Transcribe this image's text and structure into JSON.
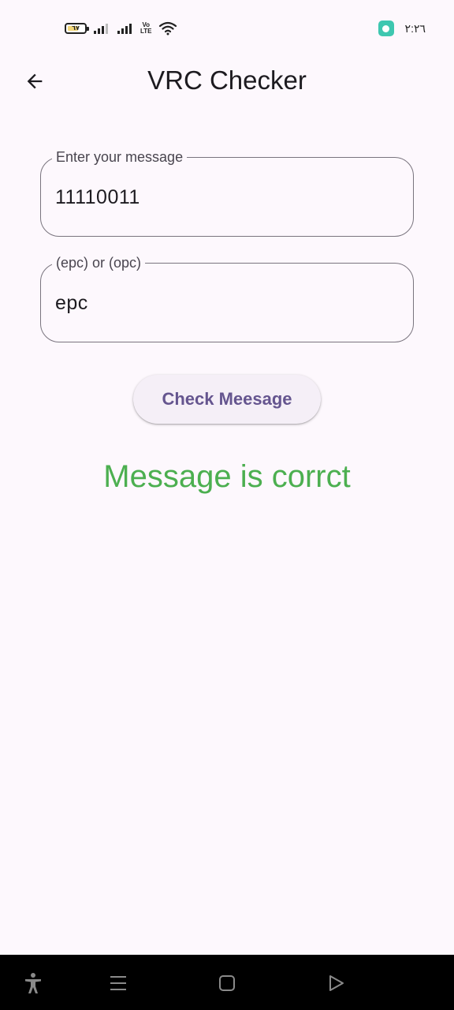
{
  "status_bar": {
    "battery_level": "٦٧",
    "battery_fraction": 0.67,
    "volte_label_top": "Vo",
    "volte_label_bottom": "LTE",
    "time": "٢:٢٦"
  },
  "app_bar": {
    "title": "VRC Checker",
    "back_icon": "arrow-left-icon"
  },
  "form": {
    "message_field": {
      "label": "Enter your message",
      "value": "11110011"
    },
    "type_field": {
      "label": "(epc) or (opc)",
      "value": "epc"
    },
    "check_button_label": "Check Meesage"
  },
  "result": {
    "text": "Message is corrct",
    "color": "#4caf50"
  },
  "nav_bar": {
    "icons": [
      "accessibility-icon",
      "menu-icon",
      "home-icon",
      "back-icon"
    ]
  },
  "colors": {
    "background": "#fdf8fd",
    "button_background": "#f5eff7",
    "button_text": "#65558f",
    "field_border": "#79747e"
  }
}
